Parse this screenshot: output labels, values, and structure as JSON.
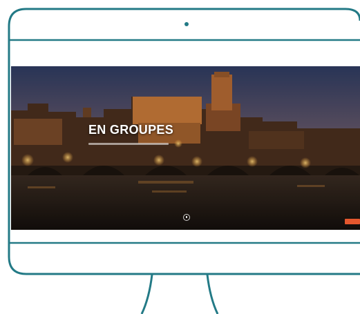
{
  "hero": {
    "title": "EN GROUPES"
  },
  "colors": {
    "frame": "#237a86",
    "cta": "#e4572e"
  },
  "icons": {
    "camera": "camera-dot-icon",
    "scroll": "scroll-down-icon"
  }
}
